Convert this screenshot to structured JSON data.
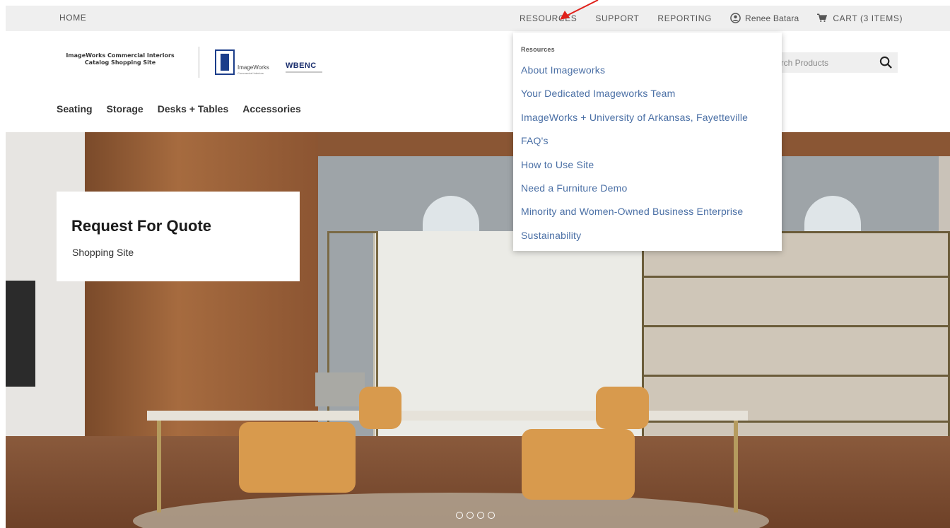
{
  "topbar": {
    "home": "HOME",
    "resources": "RESOURCES",
    "support": "SUPPORT",
    "reporting": "REPORTING",
    "user": "Renee Batara",
    "cart": "CART (3 ITEMS)"
  },
  "header": {
    "site_name_line1": "ImageWorks Commercial Interiors",
    "site_name_line2": "Catalog Shopping Site",
    "logo_name": "ImageWorks",
    "logo_sub": "Commercial Interiors",
    "wbenc": "WBENC"
  },
  "search": {
    "placeholder": "arch Products"
  },
  "nav": {
    "categories": [
      "Seating",
      "Storage",
      "Desks + Tables",
      "Accessories"
    ]
  },
  "hero": {
    "title": "Request For Quote",
    "subtitle": "Shopping Site",
    "slide_count": 4
  },
  "dropdown": {
    "heading": "Resources",
    "items": [
      "About Imageworks",
      "Your Dedicated Imageworks Team",
      "ImageWorks + University of Arkansas, Fayetteville",
      "FAQ's",
      "How to Use Site",
      "Need a Furniture Demo",
      "Minority and Women-Owned Business Enterprise",
      "Sustainability"
    ]
  },
  "colors": {
    "topbar_bg": "#efefef",
    "link_blue": "#4a6fa5",
    "annotation_red": "#e0201a"
  },
  "icons": {
    "user": "user-circle-icon",
    "cart": "cart-icon",
    "search": "search-icon",
    "annotation": "red-arrow-icon"
  }
}
